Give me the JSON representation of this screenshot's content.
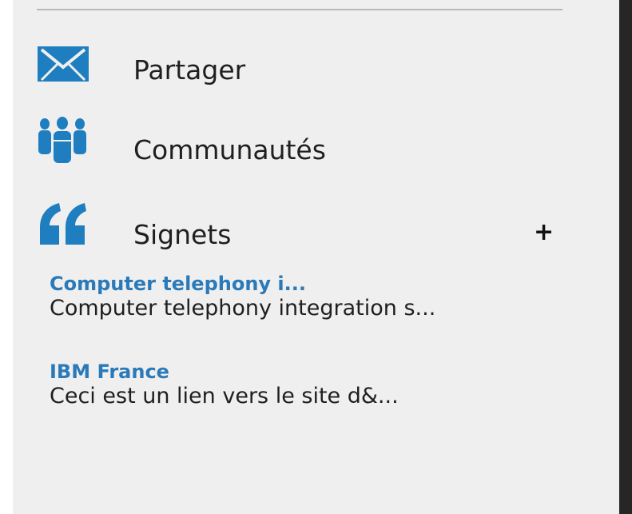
{
  "nav": {
    "share": {
      "label": "Partager",
      "icon": "envelope-icon"
    },
    "communities": {
      "label": "Communautés",
      "icon": "people-group-icon"
    },
    "bookmarks": {
      "label": "Signets",
      "icon": "quote-marks-icon",
      "add_label": "+"
    }
  },
  "bookmarks": [
    {
      "title": "Computer telephony i...",
      "description": "Computer telephony integration s..."
    },
    {
      "title": "IBM France",
      "description": "Ceci est un lien vers le site d&..."
    }
  ],
  "colors": {
    "icon_blue": "#1f7ec0",
    "link_blue": "#2a7ab9",
    "panel_bg": "#efefef",
    "dark_edge": "#262626"
  }
}
